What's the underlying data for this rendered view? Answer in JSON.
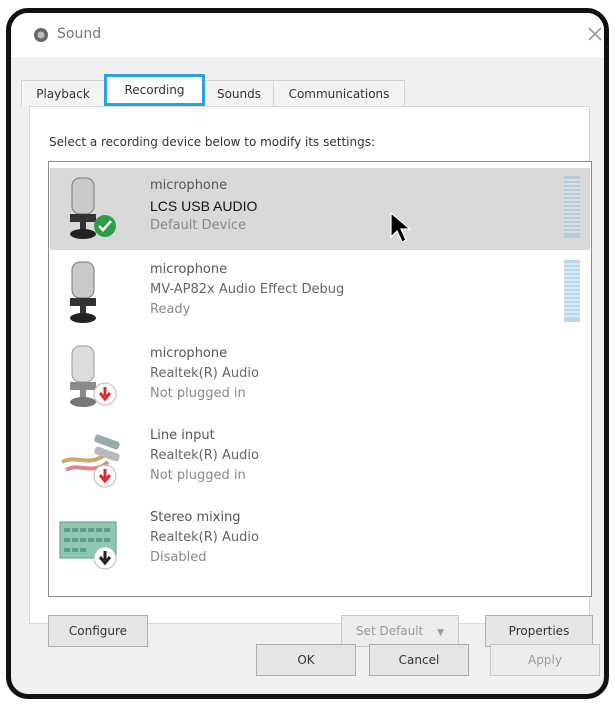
{
  "window": {
    "title": "Sound"
  },
  "tabs": [
    {
      "label": "Playback"
    },
    {
      "label": "Recording"
    },
    {
      "label": "Sounds"
    },
    {
      "label": "Communications"
    }
  ],
  "instruction": "Select a recording device below to modify its settings:",
  "devices": [
    {
      "name": "microphone",
      "description": "LCS USB AUDIO",
      "status": "Default Device",
      "icon": "microphone-icon",
      "badge": "default-check",
      "selected": true
    },
    {
      "name": "microphone",
      "description": "MV-AP82x Audio Effect Debug",
      "status": "Ready",
      "icon": "microphone-icon",
      "badge": "none",
      "selected": false
    },
    {
      "name": "microphone",
      "description": "Realtek(R) Audio",
      "status": "Not plugged in",
      "icon": "microphone-icon",
      "badge": "unplugged-arrow",
      "selected": false
    },
    {
      "name": "Line input",
      "description": "Realtek(R) Audio",
      "status": "Not plugged in",
      "icon": "line-input-icon",
      "badge": "unplugged-arrow",
      "selected": false
    },
    {
      "name": "Stereo mixing",
      "description": "Realtek(R) Audio",
      "status": "Disabled",
      "icon": "stereo-mix-icon",
      "badge": "disabled-arrow",
      "selected": false
    }
  ],
  "buttons": {
    "configure": "Configure",
    "set_default": "Set Default",
    "set_default_arrow": "▼",
    "properties": "Properties",
    "ok": "OK",
    "cancel": "Cancel",
    "apply": "Apply"
  },
  "colors": {
    "active_tab_highlight": "#2aa3dc",
    "selected_row": "#d9d9d9",
    "default_badge": "#2e9e48",
    "unplugged_badge": "#d92b2b"
  }
}
